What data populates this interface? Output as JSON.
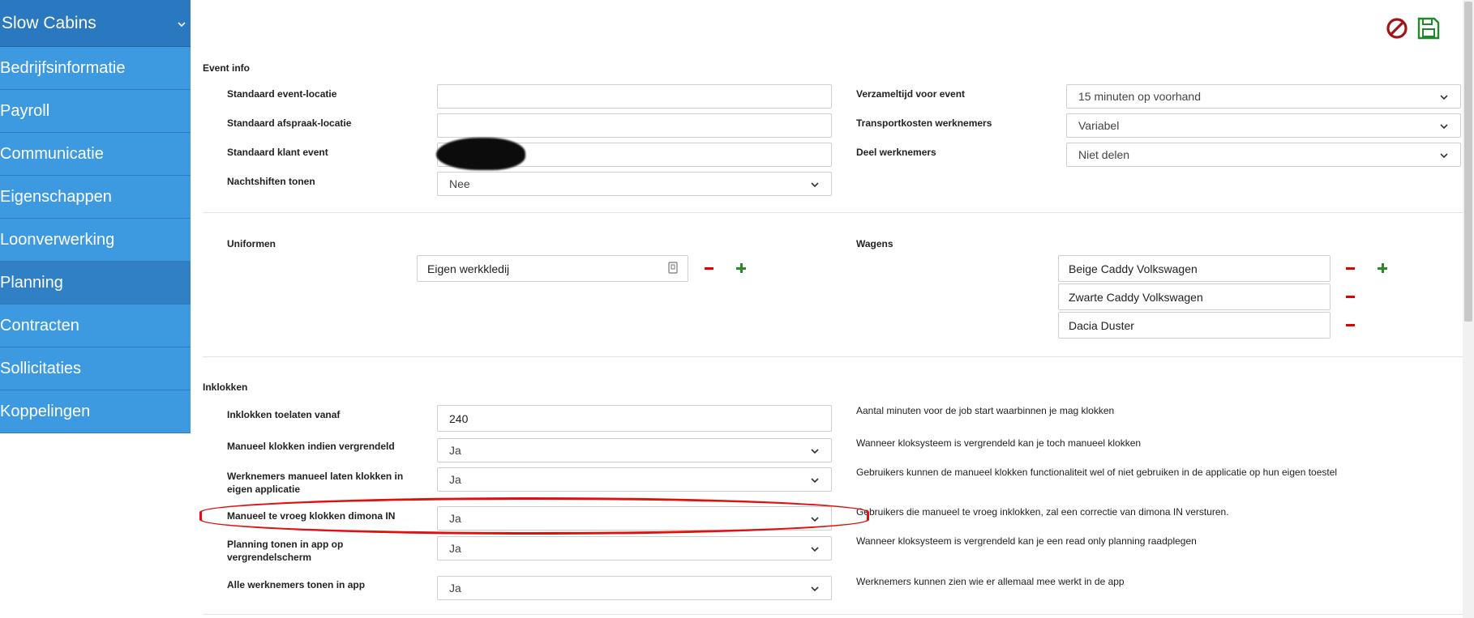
{
  "sidebar": {
    "header": "Slow Cabins",
    "items": [
      {
        "label": "Bedrijfsinformatie"
      },
      {
        "label": "Payroll"
      },
      {
        "label": "Communicatie"
      },
      {
        "label": "Eigenschappen"
      },
      {
        "label": "Loonverwerking"
      },
      {
        "label": "Planning"
      },
      {
        "label": "Contracten"
      },
      {
        "label": "Sollicitaties"
      },
      {
        "label": "Koppelingen"
      }
    ]
  },
  "toolbar": {
    "cancel_icon": "ban-icon",
    "save_icon": "floppy-disk-icon"
  },
  "event_info": {
    "title": "Event info",
    "std_location_label": "Standaard event-locatie",
    "std_location_value": "",
    "std_appointment_label": "Standaard afspraak-locatie",
    "std_appointment_value": "",
    "std_client_label": "Standaard klant event",
    "night_shifts_label": "Nachtshiften tonen",
    "night_shifts_value": "Nee",
    "gather_time_label": "Verzameltijd voor event",
    "gather_time_value": "15 minuten op voorhand",
    "transport_label": "Transportkosten werknemers",
    "transport_value": "Variabel",
    "share_label": "Deel werknemers",
    "share_value": "Niet delen"
  },
  "uniforms": {
    "title": "Uniformen",
    "items": [
      "Eigen werkkledij"
    ]
  },
  "wagens": {
    "title": "Wagens",
    "items": [
      "Beige Caddy Volkswagen",
      "Zwarte Caddy Volkswagen",
      "Dacia Duster"
    ]
  },
  "inklokken": {
    "title": "Inklokken",
    "rows": [
      {
        "label": "Inklokken toelaten vanaf",
        "value": "240",
        "help": "Aantal minuten voor de job start waarbinnen je mag klokken"
      },
      {
        "label": "Manueel klokken indien vergrendeld",
        "value": "Ja",
        "help": "Wanneer kloksysteem is vergrendeld kan je toch manueel klokken"
      },
      {
        "label": "Werknemers manueel laten klokken in eigen applicatie",
        "value": "Ja",
        "help": "Gebruikers kunnen de manueel klokken functionaliteit wel of niet gebruiken in de applicatie op hun eigen toestel"
      },
      {
        "label": "Manueel te vroeg klokken dimona IN",
        "value": "Ja",
        "help": "Gebruikers die manueel te vroeg inklokken, zal een correctie van dimona IN versturen."
      },
      {
        "label": "Planning tonen in app op vergrendelscherm",
        "value": "Ja",
        "help": "Wanneer kloksysteem is vergrendeld kan je een read only planning raadplegen"
      },
      {
        "label": "Alle werknemers tonen in app",
        "value": "Ja",
        "help": "Werknemers kunnen zien wie er allemaal mee werkt in de app"
      }
    ]
  }
}
